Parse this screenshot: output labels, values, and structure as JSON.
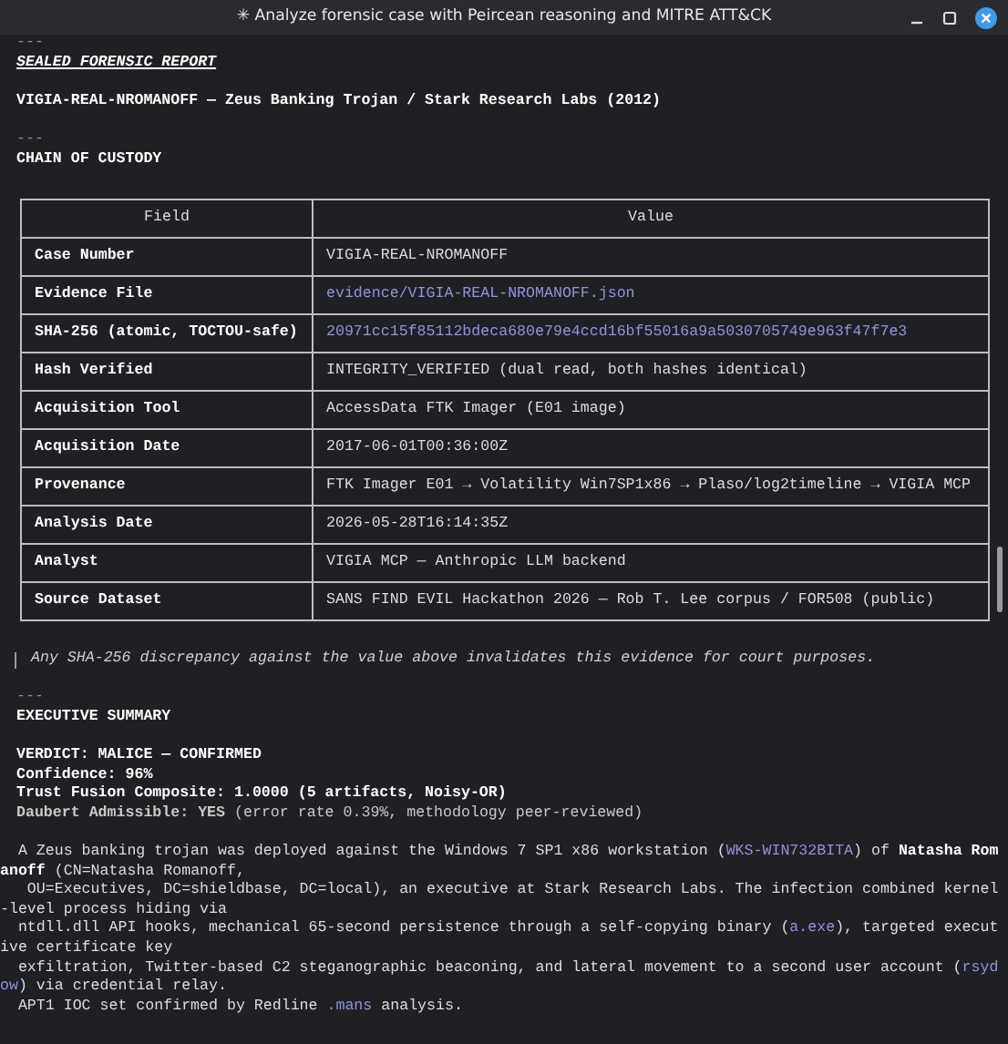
{
  "window": {
    "title": "✳ Analyze forensic case with Peircean reasoning and MITRE ATT&CK"
  },
  "header": {
    "rule_top": "---",
    "sealed_label": "SEALED FORENSIC REPORT",
    "case_title": "VIGIA-REAL-NROMANOFF — Zeus Banking Trojan / Stark Research Labs (2012)",
    "rule_mid": "---",
    "section_title": "CHAIN OF CUSTODY"
  },
  "table": {
    "columns": [
      "Field",
      "Value"
    ],
    "rows": [
      {
        "field": "Case Number",
        "value": "VIGIA-REAL-NROMANOFF",
        "kind": "text"
      },
      {
        "field": "Evidence File",
        "value": "evidence/VIGIA-REAL-NROMANOFF.json",
        "kind": "code"
      },
      {
        "field": "SHA-256 (atomic, TOCTOU-safe)",
        "value": "20971cc15f85112bdeca680e79e4ccd16bf55016a9a5030705749e963f47f7e3",
        "kind": "code"
      },
      {
        "field": "Hash Verified",
        "value": "INTEGRITY_VERIFIED (dual read, both hashes identical)",
        "kind": "text"
      },
      {
        "field": "Acquisition Tool",
        "value": "AccessData FTK Imager (E01 image)",
        "kind": "text"
      },
      {
        "field": "Acquisition Date",
        "value": "2017-06-01T00:36:00Z",
        "kind": "text"
      },
      {
        "field": "Provenance",
        "value": "FTK Imager E01 → Volatility Win7SP1x86 → Plaso/log2timeline → VIGIA MCP",
        "kind": "text"
      },
      {
        "field": "Analysis Date",
        "value": "2026-05-28T16:14:35Z",
        "kind": "text"
      },
      {
        "field": "Analyst",
        "value": "VIGIA MCP — Anthropic LLM backend",
        "kind": "text"
      },
      {
        "field": "Source Dataset",
        "value": "SANS FIND EVIL Hackathon 2026 — Rob T. Lee corpus / FOR508 (public)",
        "kind": "text"
      }
    ]
  },
  "quote": "Any SHA-256 discrepancy against the value above invalidates this evidence for court purposes.",
  "summary": {
    "rule": "---",
    "title": "EXECUTIVE SUMMARY",
    "facts": [
      {
        "text": "VERDICT: MALICE — CONFIRMED",
        "kind": "bold"
      },
      {
        "text": "Confidence: 96%",
        "kind": "bold"
      },
      {
        "text": "Trust Fusion Composite: 1.0000 (5 artifacts, Noisy-OR)",
        "kind": "bold"
      },
      {
        "text": "**Daubert Admissible: YES** (error rate 0.39%, methodology peer-reviewed)",
        "kind": "mixed"
      }
    ],
    "paragraph_lines": [
      [
        {
          "text": "  A Zeus banking trojan was deployed against the Windows 7 SP1 x86 workstation (",
          "kind": "plain"
        },
        {
          "text": "WKS-WIN732BITA",
          "kind": "code"
        },
        {
          "text": ") of ",
          "kind": "plain"
        },
        {
          "text": "Natasha Rom",
          "kind": "bold"
        }
      ],
      [
        {
          "text": "anoff",
          "kind": "bold"
        },
        {
          "text": " (CN=Natasha Romanoff,",
          "kind": "plain"
        }
      ],
      [
        {
          "text": "   OU=Executives, DC=shieldbase, DC=local), an executive at Stark Research Labs. The infection combined kernel",
          "kind": "plain"
        }
      ],
      [
        {
          "text": "-level process hiding via",
          "kind": "plain"
        }
      ],
      [
        {
          "text": "  ntdll.dll API hooks, mechanical 65-second persistence through a self-copying binary (",
          "kind": "plain"
        },
        {
          "text": "a.exe",
          "kind": "code"
        },
        {
          "text": "), targeted execut",
          "kind": "plain"
        }
      ],
      [
        {
          "text": "ive certificate key",
          "kind": "plain"
        }
      ],
      [
        {
          "text": "  exfiltration, Twitter-based C2 steganographic beaconing, and lateral movement to a second user account (",
          "kind": "plain"
        },
        {
          "text": "rsyd",
          "kind": "code"
        }
      ],
      [
        {
          "text": "ow",
          "kind": "code"
        },
        {
          "text": ") via credential relay.",
          "kind": "plain"
        }
      ],
      [
        {
          "text": "  APT1 IOC set confirmed by Redline ",
          "kind": "plain"
        },
        {
          "text": ".mans",
          "kind": "code"
        },
        {
          "text": " analysis.",
          "kind": "plain"
        }
      ]
    ]
  }
}
